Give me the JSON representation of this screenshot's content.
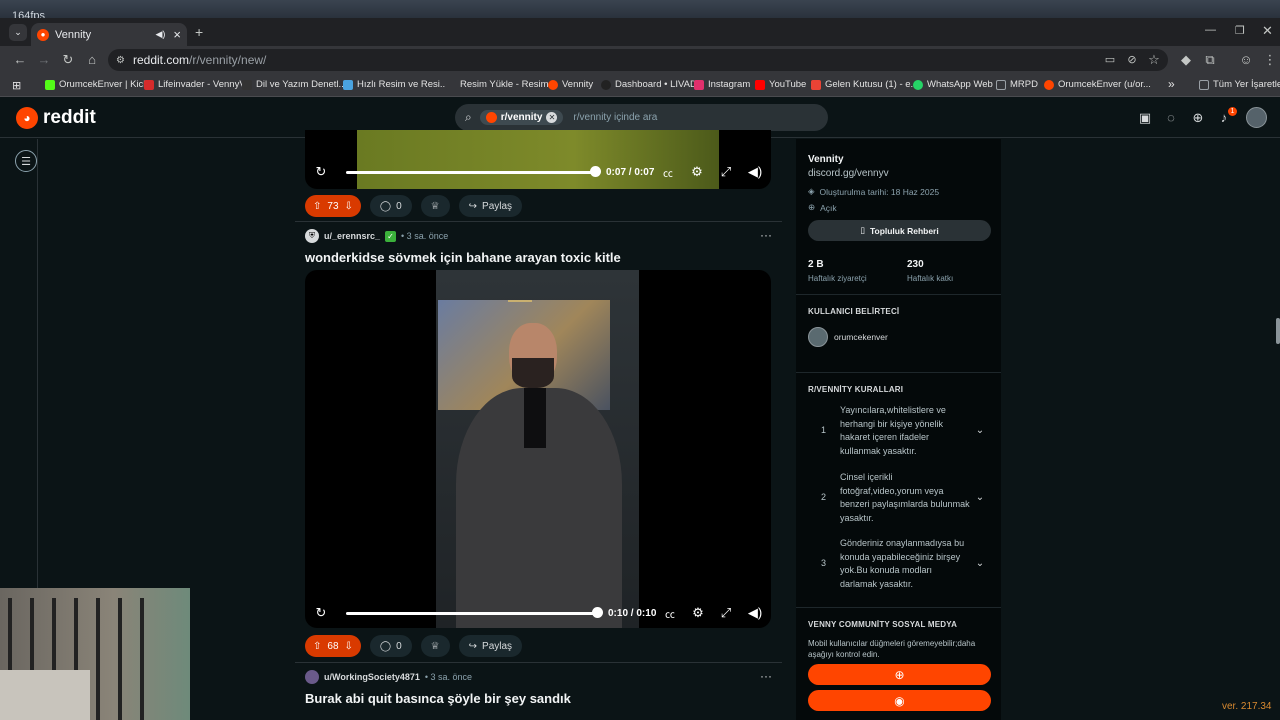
{
  "os": {
    "fps": "164fps",
    "version": "ver. 217.34"
  },
  "browser": {
    "tab": {
      "title": "Vennity",
      "close": "×"
    },
    "new_tab": "+",
    "url_host": "reddit.com",
    "url_path": "/r/vennity/new/",
    "bookmarks": [
      {
        "label": "OrumcekEnver | Kick",
        "color": "#53fc18"
      },
      {
        "label": "Lifeinvader - VennyV",
        "color": "#d62b2b"
      },
      {
        "label": "Dil ve Yazım Denetl...",
        "color": "#333333"
      },
      {
        "label": "Hızlı Resim ve Resi...",
        "color": "#4aa3df"
      },
      {
        "label": "Resim Yükle - Resim...",
        "color": "#35363a"
      },
      {
        "label": "Vennity",
        "color": "#ff4500"
      },
      {
        "label": "Dashboard • LIVAD",
        "color": "#222222"
      },
      {
        "label": "Instagram",
        "color": "#e1306c"
      },
      {
        "label": "YouTube",
        "color": "#ff0000"
      },
      {
        "label": "Gelen Kutusu (1) - e...",
        "color": "#ea4335"
      },
      {
        "label": "WhatsApp Web",
        "color": "#25d366"
      },
      {
        "label": "MRPD",
        "color": "#9aa0a6"
      },
      {
        "label": "OrumcekEnver (u/or...",
        "color": "#ff4500"
      }
    ],
    "more_bookmarks": "»",
    "all_bookmarks": "Tüm Yer İşaretleri"
  },
  "header": {
    "logo_text": "reddit",
    "search_chip": "r/vennity",
    "search_placeholder": "r/vennity içinde ara",
    "notification_count": "1"
  },
  "posts": [
    {
      "time_current": "0:07",
      "time_total": "0:07",
      "time_sep": "/",
      "votes": "73",
      "comments": "0",
      "share": "Paylaş",
      "progress": 1.0
    },
    {
      "author": "u/_erennsrc_",
      "time": "• 3 sa. önce",
      "title": "wonderkidse sövmek için bahane arayan toxic kitle",
      "time_current": "0:10",
      "time_total": "0:10",
      "time_sep": "/",
      "votes": "68",
      "comments": "0",
      "share": "Paylaş",
      "progress": 1.0
    },
    {
      "author": "u/WorkingSociety4871",
      "time": "• 3 sa. önce",
      "title": "Burak abi quit basınca şöyle bir şey sandık"
    }
  ],
  "sidebar": {
    "name": "Vennity",
    "link": "discord.gg/vennyv",
    "created": "Oluşturulma tarihi: 18 Haz 2025",
    "visibility": "Açık",
    "guide_button": "Topluluk Rehberi",
    "stats": [
      {
        "value": "2 B",
        "label": "Haftalık ziyaretçi"
      },
      {
        "value": "230",
        "label": "Haftalık katkı"
      }
    ],
    "user_flair_title": "KULLANICI BELİRTECİ",
    "user_flair_name": "orumcekenver",
    "rules_title": "R/VENNİTY KURALLARI",
    "rules": [
      {
        "num": "1",
        "text": "Yayıncılara,whitelistlere ve herhangi bir kişiye yönelik hakaret içeren ifadeler kullanmak yasaktır."
      },
      {
        "num": "2",
        "text": "Cinsel içerikli fotoğraf,video,yorum veya benzeri paylaşımlarda bulunmak yasaktır."
      },
      {
        "num": "3",
        "text": "Gönderiniz onaylanmadıysa bu konuda yapabileceğiniz birşey yok.Bu konuda modları darlamak yasaktır."
      }
    ],
    "social_title": "VENNY COMMUNİTY SOSYAL MEDYA",
    "social_desc": "Mobil kullanıcılar düğmeleri göremeyebilir;daha aşağıyı kontrol edin."
  }
}
